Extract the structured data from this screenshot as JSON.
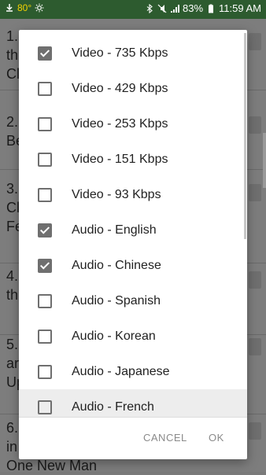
{
  "status_bar": {
    "temperature": "80°",
    "battery": "83%",
    "time": "11:59 AM"
  },
  "background_list": [
    {
      "lines": [
        "1.",
        "th",
        "Cl"
      ]
    },
    {
      "lines": [
        "2.",
        "Be"
      ]
    },
    {
      "lines": [
        "3.",
        "Cl",
        "Fe"
      ]
    },
    {
      "lines": [
        "4.",
        "th"
      ]
    },
    {
      "lines": [
        "5.",
        "ar",
        "Up"
      ]
    },
    {
      "lines": [
        "6.",
        "in",
        "One New Man"
      ]
    }
  ],
  "dialog": {
    "options": [
      {
        "label": "Video - 735 Kbps",
        "checked": true
      },
      {
        "label": "Video - 429 Kbps",
        "checked": false
      },
      {
        "label": "Video - 253 Kbps",
        "checked": false
      },
      {
        "label": "Video - 151 Kbps",
        "checked": false
      },
      {
        "label": "Video - 93 Kbps",
        "checked": false
      },
      {
        "label": "Audio - English",
        "checked": true
      },
      {
        "label": "Audio - Chinese",
        "checked": true
      },
      {
        "label": "Audio - Spanish",
        "checked": false
      },
      {
        "label": "Audio - Korean",
        "checked": false
      },
      {
        "label": "Audio - Japanese",
        "checked": false
      },
      {
        "label": "Audio - French",
        "checked": false
      }
    ],
    "cancel_label": "CANCEL",
    "ok_label": "OK"
  }
}
